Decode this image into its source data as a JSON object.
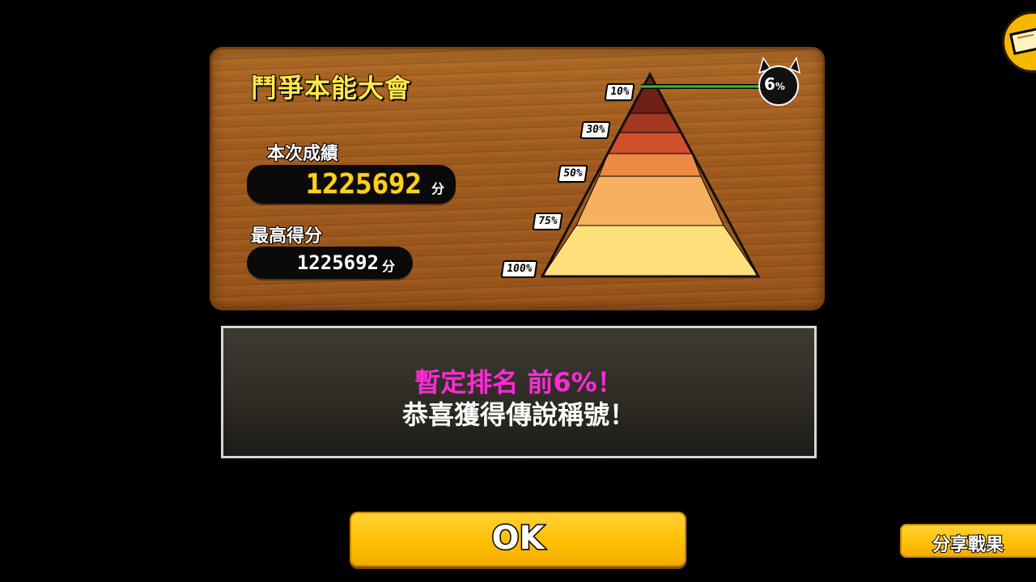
{
  "panel": {
    "title": "鬥爭本能大會",
    "current_label": "本次成績",
    "current_score": "1225692",
    "current_unit": "分",
    "best_label": "最高得分",
    "best_score": "1225692",
    "best_unit": "分"
  },
  "ranking_pyramid": {
    "tiers": [
      {
        "label": "10%",
        "color": "#6e2016"
      },
      {
        "label": "30%",
        "color": "#a83822"
      },
      {
        "label": "50%",
        "color": "#d9532e"
      },
      {
        "label": "75%",
        "color": "#f39a4d"
      },
      {
        "label": "100%",
        "color": "#fde07a"
      }
    ],
    "marker": {
      "value_label": "6",
      "value_unit": "%"
    },
    "marker_line_color": "#3fbf2a"
  },
  "message": {
    "line1": "暫定排名 前6%！",
    "line2": "恭喜獲得傳說稱號！",
    "line1_color": "#ff2ad8"
  },
  "buttons": {
    "ok": "OK",
    "share": "分享戰果"
  },
  "corner_icon": "map-icon"
}
